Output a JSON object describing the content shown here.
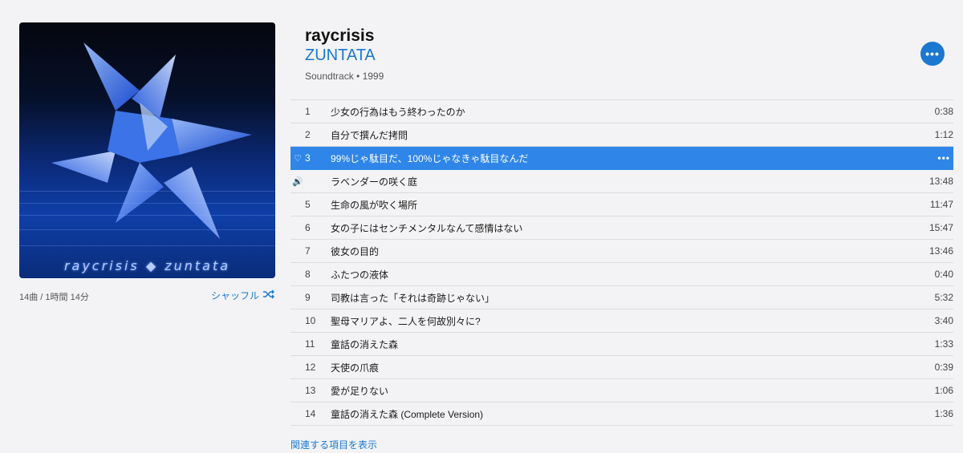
{
  "album": {
    "title": "raycrisis",
    "artist": "ZUNTATA",
    "genre_year": "Soundtrack • 1999",
    "art_caption": "raycrisis ◆ zuntata",
    "summary": "14曲 / 1時間 14分",
    "shuffle_label": "シャッフル",
    "more_label": "•••"
  },
  "tracks": [
    {
      "num": "1",
      "title": "少女の行為はもう終わったのか",
      "duration": "0:38"
    },
    {
      "num": "2",
      "title": "自分で撰んだ拷問",
      "duration": "1:12"
    },
    {
      "num": "3",
      "title": "99%じゃ駄目だ、100%じゃなきゃ駄目なんだ",
      "duration": "•••"
    },
    {
      "num": "",
      "title": "ラベンダーの咲く庭",
      "duration": "13:48"
    },
    {
      "num": "5",
      "title": "生命の風が吹く場所",
      "duration": "11:47"
    },
    {
      "num": "6",
      "title": "女の子にはセンチメンタルなんて感情はない",
      "duration": "15:47"
    },
    {
      "num": "7",
      "title": "彼女の目的",
      "duration": "13:46"
    },
    {
      "num": "8",
      "title": "ふたつの液体",
      "duration": "0:40"
    },
    {
      "num": "9",
      "title": "司教は言った「それは奇跡じゃない」",
      "duration": "5:32"
    },
    {
      "num": "10",
      "title": "聖母マリアよ、二人を何故別々に?",
      "duration": "3:40"
    },
    {
      "num": "11",
      "title": "童話の消えた森",
      "duration": "1:33"
    },
    {
      "num": "12",
      "title": "天使の爪痕",
      "duration": "0:39"
    },
    {
      "num": "13",
      "title": "愛が足りない",
      "duration": "1:06"
    },
    {
      "num": "14",
      "title": "童話の消えた森 (Complete Version)",
      "duration": "1:36"
    }
  ],
  "selected_track_index": 2,
  "playing_track_index": 3,
  "icons": {
    "heart": "heart-icon",
    "speaker": "speaker-icon",
    "shuffle": "shuffle-icon",
    "more": "more-icon"
  },
  "colors": {
    "accent": "#1b78d0",
    "selection": "#2f86e8",
    "background": "#f3f3f5"
  },
  "related_link": "関連する項目を表示"
}
